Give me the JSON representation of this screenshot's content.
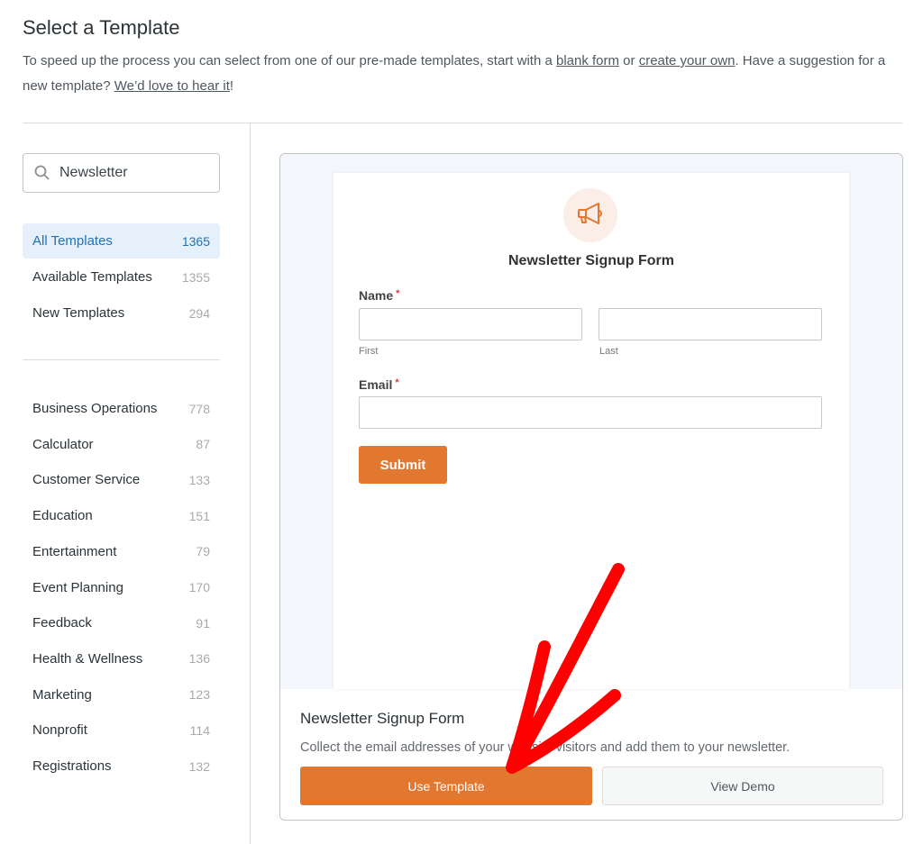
{
  "header": {
    "title": "Select a Template",
    "intro_1": "To speed up the process you can select from one of our pre-made templates, start with a ",
    "link_blank": "blank form",
    "intro_2": " or ",
    "link_create": "create your own",
    "intro_3": ". Have a suggestion for a new template? ",
    "link_hear": "We’d love to hear it",
    "intro_4": "!"
  },
  "search": {
    "value": "Newsletter",
    "icon": "search-icon"
  },
  "sidebar": {
    "main": [
      {
        "label": "All Templates",
        "count": "1365",
        "active": true
      },
      {
        "label": "Available Templates",
        "count": "1355"
      },
      {
        "label": "New Templates",
        "count": "294"
      }
    ],
    "categories": [
      {
        "label": "Business Operations",
        "count": "778"
      },
      {
        "label": "Calculator",
        "count": "87"
      },
      {
        "label": "Customer Service",
        "count": "133"
      },
      {
        "label": "Education",
        "count": "151"
      },
      {
        "label": "Entertainment",
        "count": "79"
      },
      {
        "label": "Event Planning",
        "count": "170"
      },
      {
        "label": "Feedback",
        "count": "91"
      },
      {
        "label": "Health & Wellness",
        "count": "136"
      },
      {
        "label": "Marketing",
        "count": "123"
      },
      {
        "label": "Nonprofit",
        "count": "114"
      },
      {
        "label": "Registrations",
        "count": "132"
      }
    ]
  },
  "preview": {
    "icon": "megaphone-icon",
    "title": "Newsletter Signup Form",
    "name_label": "Name",
    "first": "First",
    "last": "Last",
    "email_label": "Email",
    "required": "*",
    "submit": "Submit"
  },
  "template": {
    "title": "Newsletter Signup Form",
    "description": "Collect the email addresses of your website visitors and add them to your newsletter.",
    "use_label": "Use Template",
    "demo_label": "View Demo"
  },
  "colors": {
    "accent": "#e27730",
    "active_bg": "#e6f0fb",
    "active_text": "#2271b1",
    "annotation_arrow": "#ff0000"
  }
}
